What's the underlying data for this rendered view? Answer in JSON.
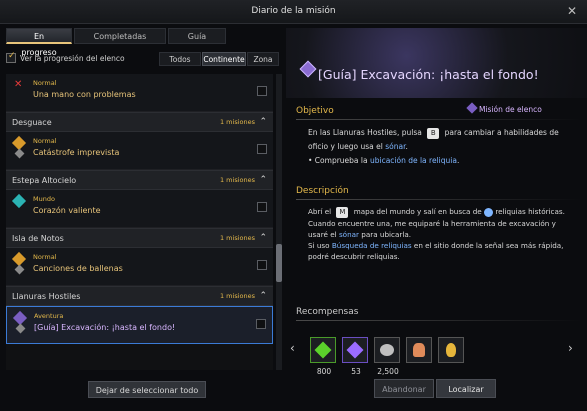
{
  "window": {
    "title": "Diario de la misión",
    "close_glyph": "✕"
  },
  "tabs": [
    "En progreso",
    "Completadas",
    "Guía"
  ],
  "filter": {
    "checkbox_label": "Ver la progresión del elenco",
    "options": [
      "Todos",
      "Continente",
      "Zona"
    ]
  },
  "list": {
    "first_quest": {
      "kind": "Normal",
      "name": "Una mano con problemas"
    },
    "groups": [
      {
        "name": "Desguace",
        "count": "1 misiones",
        "quest": {
          "kind": "Normal",
          "name": "Catástrofe imprevista"
        }
      },
      {
        "name": "Estepa Altocielo",
        "count": "1 misiones",
        "quest": {
          "kind": "Mundo",
          "name": "Corazón valiente"
        }
      },
      {
        "name": "Isla de Notos",
        "count": "1 misiones",
        "quest": {
          "kind": "Normal",
          "name": "Canciones de ballenas"
        }
      },
      {
        "name": "Llanuras Hostiles",
        "count": "1 misiones",
        "quest": {
          "kind": "Aventura",
          "name": "[Guía] Excavación: ¡hasta el fondo!"
        }
      }
    ]
  },
  "deselect_label": "Dejar de seleccionar todo",
  "detail": {
    "title": "[Guía] Excavación: ¡hasta el fondo!",
    "objective_title": "Objetivo",
    "cast_mission_label": "Misión de elenco",
    "objective": {
      "pre": "En las Llanuras Hostiles, pulsa",
      "key": "B",
      "mid": "para cambiar a habilidades de oficio y luego usa el",
      "link": "sónar",
      "post": "."
    },
    "bullet": {
      "pre": "• Comprueba la",
      "link": "ubicación de la reliquia",
      "post": "."
    },
    "description_title": "Descripción",
    "description": {
      "p1a": "Abrí el",
      "p1key": "M",
      "p1b": "mapa del mundo y salí en busca de",
      "p1c": "reliquias históricas.",
      "p2a": "Cuando encuentre una, me equiparé la herramienta de excavación y usaré el",
      "p2link": "sónar",
      "p2b": "para ubicarla.",
      "p3a": "Si uso",
      "p3link": "Búsqueda de reliquias",
      "p3b": "en el sitio donde la señal sea más rápida, podré descubrir reliquias."
    },
    "rewards_title": "Recompensas",
    "rewards": [
      "800",
      "53",
      "2,500",
      "",
      ""
    ],
    "buttons": {
      "abandon": "Abandonar",
      "locate": "Localizar"
    }
  }
}
